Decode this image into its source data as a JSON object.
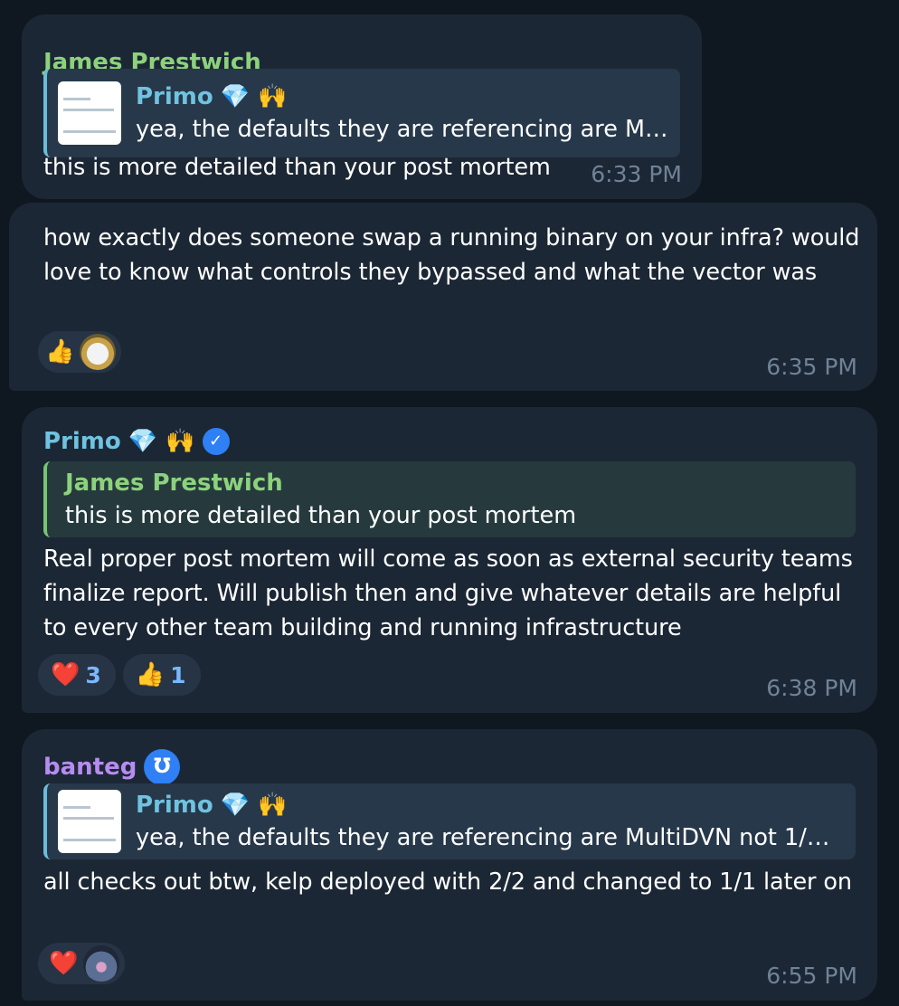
{
  "colors": {
    "james": "#8cd27c",
    "primo": "#6fc3e0",
    "banteg": "#b78cf0",
    "verified": "#2f7ff5"
  },
  "messages": [
    {
      "sender": "James Prestwich",
      "reply_to": {
        "name": "Primo",
        "emojis": "💎 🙌",
        "text": "yea, the defaults they are referencing are M…",
        "thumbnail": "thumbnail"
      },
      "text": "this is more detailed than your post mortem",
      "time": "6:33 PM"
    },
    {
      "text": "how exactly does someone swap a running binary on your infra? would love to know what controls they bypassed and what the vector was",
      "reactions": [
        {
          "emoji": "👍",
          "count": ""
        },
        {
          "emoji": "avatar-loki-icon",
          "count": ""
        }
      ],
      "time": "6:35 PM"
    },
    {
      "sender": "Primo",
      "sender_emojis": "💎 🙌",
      "verified_icon": "verified-check-icon",
      "reply_to": {
        "name": "James Prestwich",
        "text": "this is more detailed than your post mortem"
      },
      "text": "Real proper post mortem will come as soon as external security teams finalize report. Will publish then and give whatever details are helpful to every other team building and running infrastructure",
      "reactions": [
        {
          "emoji": "❤️",
          "count": "3"
        },
        {
          "emoji": "👍",
          "count": "1"
        }
      ],
      "time": "6:38 PM"
    },
    {
      "sender": "banteg",
      "sender_icon": "banteg-badge-icon",
      "reply_to": {
        "name": "Primo",
        "emojis": "💎 🙌",
        "text": "yea, the defaults they are referencing are MultiDVN not 1/…",
        "thumbnail": "thumbnail"
      },
      "text": "all checks out btw, kelp deployed with 2/2 and changed to 1/1 later on",
      "reactions": [
        {
          "emoji": "❤️",
          "count": ""
        },
        {
          "emoji": "avatar-landscape-icon",
          "count": ""
        }
      ],
      "time": "6:55 PM"
    }
  ]
}
